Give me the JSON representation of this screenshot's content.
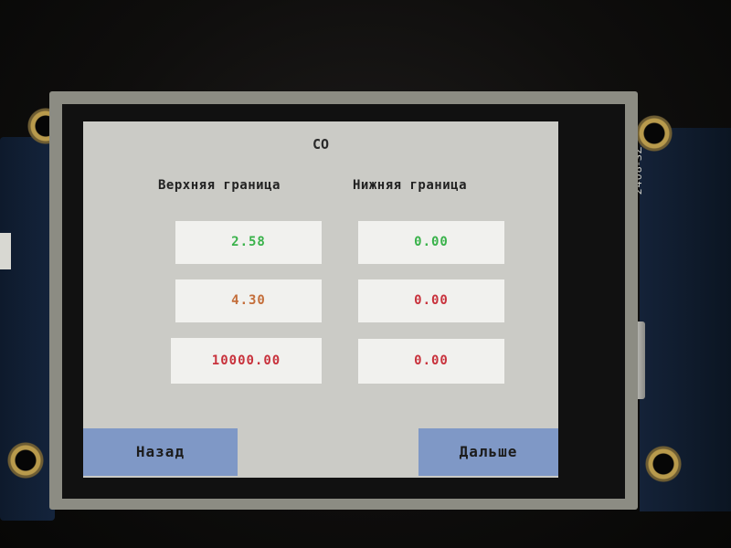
{
  "board": {
    "silkscreen": "2408-SZ"
  },
  "screen": {
    "title": "CO",
    "upper_header": "Верхняя граница",
    "lower_header": "Нижняя граница",
    "upper_values": [
      "2.58",
      "4.30",
      "10000.00"
    ],
    "lower_values": [
      "0.00",
      "0.00",
      "0.00"
    ],
    "colors": {
      "green": "#39b24a",
      "orange": "#c46e3a",
      "red": "#c8323c",
      "field_bg": "#f1f1ee",
      "button_bg": "#7f98c6",
      "screen_bg": "#cbcbc6"
    }
  },
  "buttons": {
    "back_label": "Назад",
    "next_label": "Дальше"
  }
}
